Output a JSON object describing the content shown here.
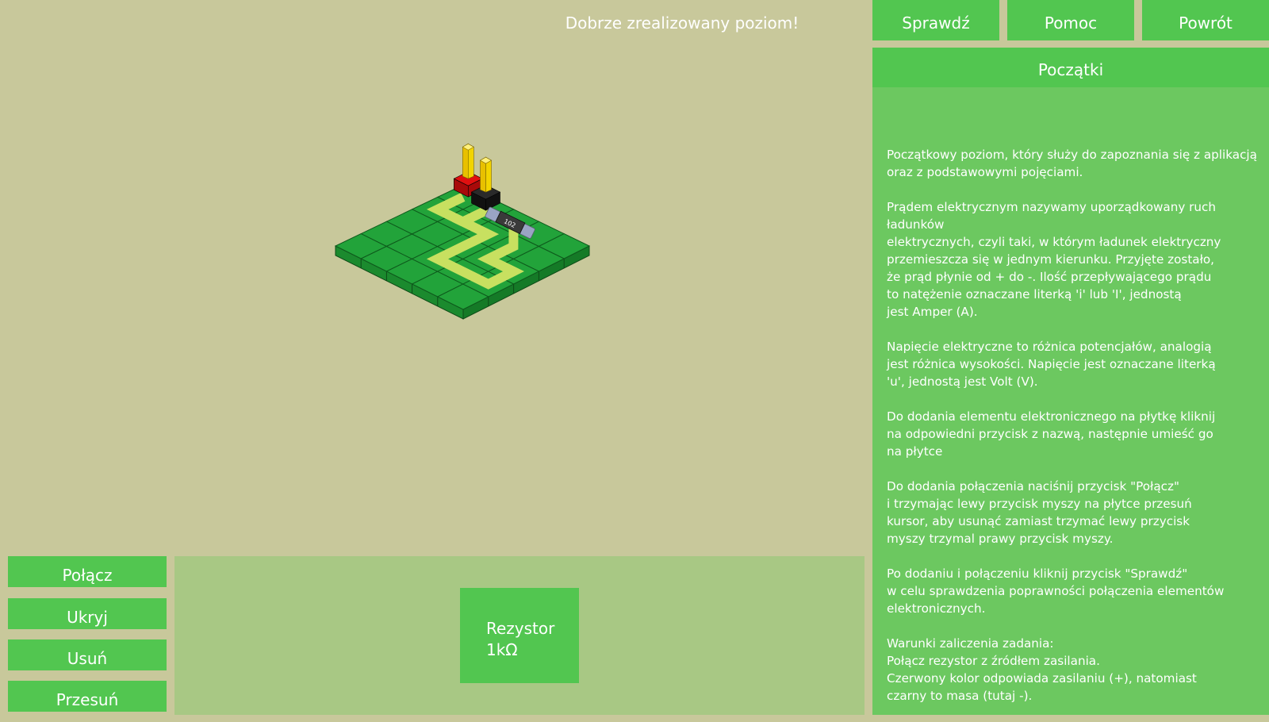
{
  "status_message": "Dobrze zrealizowany poziom!",
  "top_buttons": {
    "check": "Sprawdź",
    "help": "Pomoc",
    "back": "Powrót"
  },
  "level": {
    "title": "Początki",
    "paragraphs": [
      "Początkowy poziom, który służy do zapoznania się z aplikacją\noraz z podstawowymi pojęciami.",
      "Prądem elektrycznym nazywamy uporządkowany ruch ładunków\nelektrycznych, czyli taki, w którym ładunek elektryczny\nprzemieszcza się w jednym kierunku. Przyjęte zostało,\nże prąd płynie od + do -. Ilość przepływającego prądu\nto natężenie oznaczane literką 'i' lub 'I', jednostą\njest Amper (A).",
      "Napięcie elektryczne to różnica potencjałów, analogią\njest różnica wysokości. Napięcie jest oznaczane literką\n'u', jednostą jest Volt (V).",
      "Do dodania elementu elektronicznego na płytkę kliknij\nna odpowiedni przycisk z nazwą, następnie umieść go\nna płytce",
      "Do dodania połączenia naciśnij przycisk \"Połącz\"\ni trzymając lewy przycisk myszy na płytce przesuń\nkursor, aby usunąć zamiast trzymać lewy przycisk\nmyszy trzymal prawy przycisk myszy.",
      "Po dodaniu i połączeniu kliknij przycisk \"Sprawdź\"\nw celu sprawdzenia poprawności połączenia elementów\nelektronicznych.",
      "Warunki zaliczenia zadania:\nPołącz rezystor z źródłem zasilania.\nCzerwony kolor odpowiada zasilaniu (+), natomiast\nczarny to masa (tutaj -)."
    ]
  },
  "tools": {
    "connect": "Połącz",
    "hide": "Ukryj",
    "delete": "Usuń",
    "move": "Przesuń"
  },
  "components": [
    {
      "name": "Rezystor",
      "value": "1kΩ"
    }
  ],
  "board": {
    "resistor_marking": "102",
    "tile_color": "#22a33a",
    "trace_color": "#c8e060",
    "power_color": "#e01010",
    "ground_color": "#2a2a2a",
    "pin_color": "#f2d400"
  },
  "colors": {
    "background": "#c8c89b",
    "button": "#52c650",
    "side_panel": "#6cc860",
    "component_panel": "#a8c884"
  }
}
